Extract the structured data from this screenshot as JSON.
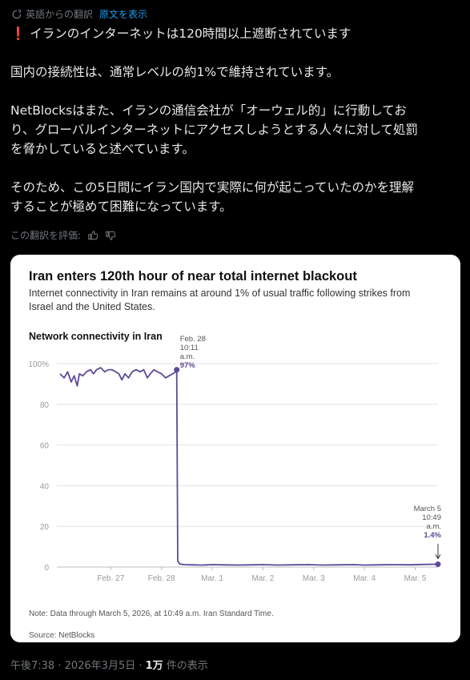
{
  "translate": {
    "label": "英語からの翻訳",
    "show_original": "原文を表示"
  },
  "post": {
    "lines": [
      "❗ イランのインターネットは120時間以上遮断されています",
      "",
      "国内の接続性は、通常レベルの約1%で維持されています。",
      "",
      "NetBlocksはまた、イランの通信会社が「オーウェル的」に行動してお",
      "り、グローバルインターネットにアクセスしようとする人々に対して処罰",
      "を脅かしていると述べています。",
      "",
      "そのため、この5日間にイラン国内で実際に何が起こっていたのかを理解",
      "することが極めて困難になっています。"
    ]
  },
  "rate": {
    "label": "この翻訳を評価:"
  },
  "chart_data": {
    "type": "line",
    "title": "Iran enters 120th hour of near total internet blackout",
    "subtitle_lines": [
      "Internet connectivity in Iran remains at around 1% of usual traffic following strikes from",
      "Israel and the United States."
    ],
    "chart_label": "Network connectivity in Iran",
    "xlabel": "",
    "ylabel": "",
    "ylim": [
      0,
      100
    ],
    "y_ticks": [
      0,
      20,
      40,
      60,
      80,
      100
    ],
    "y_tick_labels": [
      "0",
      "20",
      "40",
      "60",
      "80",
      "100%"
    ],
    "x_ticks": [
      {
        "day": 27,
        "label": "Feb. 27"
      },
      {
        "day": 28,
        "label": "Feb. 28"
      },
      {
        "day": 29,
        "label": "Mar. 1"
      },
      {
        "day": 30,
        "label": "Mar. 2"
      },
      {
        "day": 31,
        "label": "Mar. 3"
      },
      {
        "day": 32,
        "label": "Mar. 4"
      },
      {
        "day": 33,
        "label": "Mar. 5"
      }
    ],
    "xlim": [
      26.0,
      33.45
    ],
    "grid": true,
    "line_color": "#5e4a99",
    "series": [
      {
        "x": [
          26.0,
          26.08,
          26.15,
          26.22,
          26.28,
          26.34,
          26.38,
          26.45,
          26.52,
          26.6,
          26.66,
          26.72,
          26.8,
          26.88,
          26.95,
          27.02,
          27.1,
          27.16,
          27.22,
          27.28,
          27.35,
          27.42,
          27.5,
          27.58,
          27.65,
          27.72,
          27.78,
          27.85,
          27.92,
          28.0,
          28.08,
          28.15,
          28.22,
          28.28,
          28.3,
          28.32,
          28.36,
          28.45,
          28.6,
          28.8,
          29.0,
          29.2,
          29.5,
          29.8,
          30.0,
          30.3,
          30.6,
          30.9,
          31.2,
          31.5,
          31.8,
          32.0,
          32.3,
          32.6,
          32.9,
          33.2,
          33.45
        ],
        "y": [
          95,
          93,
          96,
          91,
          94,
          89,
          95,
          94,
          96,
          97,
          95,
          97,
          98,
          96,
          97,
          97,
          96,
          95,
          92,
          95,
          93,
          96,
          97,
          96,
          97,
          93,
          95,
          97,
          96,
          95,
          93,
          94,
          95,
          96,
          97,
          3,
          1.5,
          1.2,
          1.1,
          1.0,
          1.2,
          1.1,
          1.0,
          1.1,
          1.2,
          1.0,
          1.1,
          1.2,
          1.0,
          1.1,
          1.2,
          1.0,
          1.1,
          1.2,
          1.1,
          1.3,
          1.4
        ]
      }
    ],
    "annotations": [
      {
        "x": 28.3,
        "y": 97,
        "lines": [
          "Feb. 28",
          "10:11",
          "a.m."
        ],
        "value": "97%",
        "align": "start"
      },
      {
        "x": 33.45,
        "y": 1.4,
        "lines": [
          "March 5",
          "10:49",
          "a.m."
        ],
        "value": "1.4%",
        "align": "end"
      }
    ],
    "note": "Note: Data through March 5, 2026, at 10:49 a.m. Iran Standard Time.",
    "source": "Source: NetBlocks"
  },
  "footer": {
    "time": "午後7:38 · 2026年3月5日 · ",
    "views": "1万",
    "views_suffix": " 件の表示"
  }
}
